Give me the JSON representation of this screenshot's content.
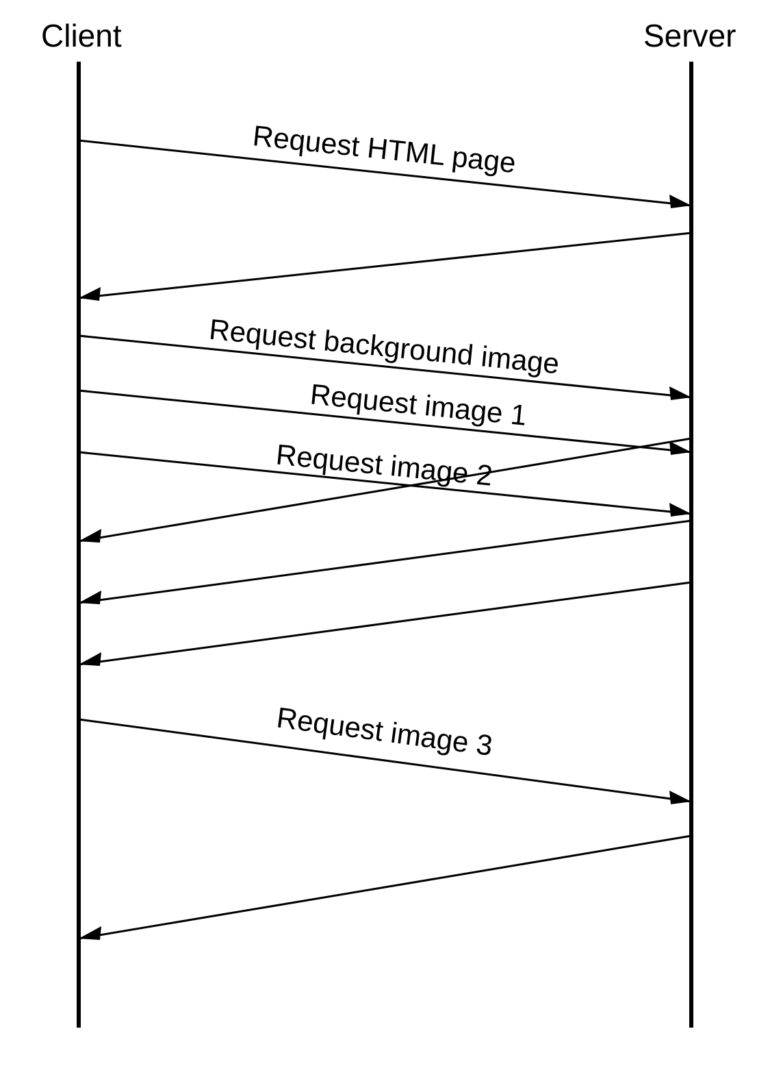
{
  "participants": {
    "client": "Client",
    "server": "Server"
  },
  "messages": {
    "req_html": "Request HTML page",
    "req_bg": "Request background image",
    "req_img1": "Request image 1",
    "req_img2": "Request image 2",
    "req_img3": "Request image 3"
  }
}
